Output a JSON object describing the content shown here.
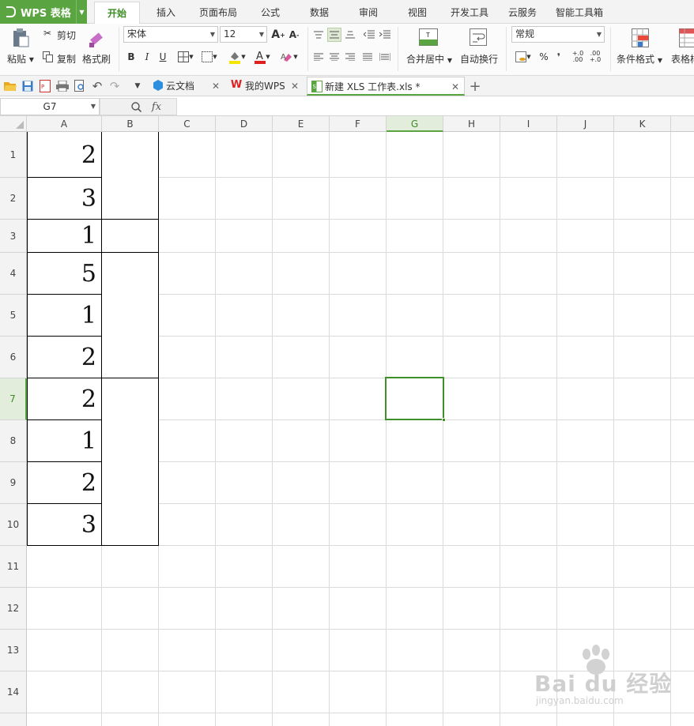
{
  "app": {
    "name": "WPS 表格"
  },
  "menu_tabs": [
    "开始",
    "插入",
    "页面布局",
    "公式",
    "数据",
    "审阅",
    "视图",
    "开发工具",
    "云服务",
    "智能工具箱"
  ],
  "active_tab": "开始",
  "ribbon": {
    "paste": "粘贴",
    "cut": "剪切",
    "copy": "复制",
    "format_painter": "格式刷",
    "font_name": "宋体",
    "font_size": "12",
    "bold": "B",
    "italic": "I",
    "underline": "U",
    "merge_center": "合并居中",
    "wrap_text": "自动换行",
    "number_format": "常规",
    "percent": "%",
    "comma": "❜",
    "inc_decimal": "+.0 .00",
    "dec_decimal": ".00 +.0",
    "conditional_format": "条件格式",
    "table_style": "表格样"
  },
  "doc_tabs": [
    {
      "label": "云文档",
      "active": false
    },
    {
      "label": "我的WPS",
      "active": false
    },
    {
      "label": "新建 XLS 工作表.xls *",
      "active": true
    }
  ],
  "formula_bar": {
    "name_box": "G7",
    "fx": "fx",
    "formula": ""
  },
  "columns": [
    "A",
    "B",
    "C",
    "D",
    "E",
    "F",
    "G",
    "H",
    "I",
    "J",
    "K"
  ],
  "selected_column": "G",
  "rows": [
    "1",
    "2",
    "3",
    "4",
    "5",
    "6",
    "7",
    "8",
    "9",
    "10",
    "11",
    "12",
    "13",
    "14"
  ],
  "selected_row": "7",
  "selected_cell": "G7",
  "cells_A": [
    "2",
    "3",
    "1",
    "5",
    "1",
    "2",
    "2",
    "1",
    "2",
    "3"
  ],
  "merged_B": [
    [
      1,
      2
    ],
    [
      3,
      3
    ],
    [
      4,
      6
    ],
    [
      7,
      10
    ]
  ],
  "watermark": {
    "brand": "Bai du 经验",
    "url": "jingyan.baidu.com"
  },
  "colors": {
    "accent": "#5aa542",
    "selection": "#3f8f2a"
  }
}
